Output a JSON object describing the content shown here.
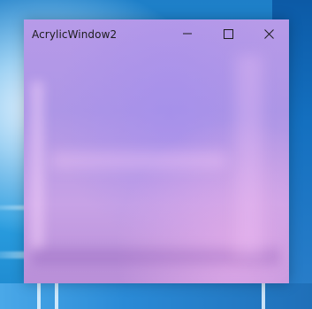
{
  "window": {
    "title": "AcrylicWindow2",
    "accent_color": "#b79ae8"
  },
  "caption_buttons": {
    "minimize_icon": "minimize-icon",
    "maximize_icon": "maximize-icon",
    "close_icon": "close-icon"
  },
  "desktop": {
    "background_color": "#1e7fc8"
  }
}
